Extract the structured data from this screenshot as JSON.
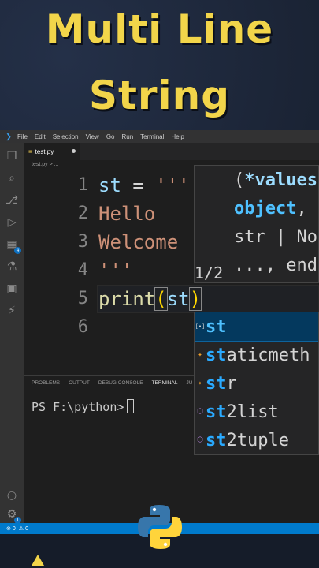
{
  "title": {
    "line1": "Multi Line",
    "line2": "String"
  },
  "menubar": {
    "items": [
      "File",
      "Edit",
      "Selection",
      "View",
      "Go",
      "Run",
      "Terminal",
      "Help"
    ]
  },
  "activitybar": {
    "badge_extensions": "4",
    "badge_settings": "1"
  },
  "tab": {
    "filename": "test.py"
  },
  "breadcrumb": {
    "text": "test.py > ..."
  },
  "editor": {
    "lines": [
      {
        "num": "1",
        "text": "st = '''"
      },
      {
        "num": "2",
        "text": "Hello"
      },
      {
        "num": "3",
        "text": "Welcome"
      },
      {
        "num": "4",
        "text": "'''"
      },
      {
        "num": "5",
        "text": "print(st)"
      },
      {
        "num": "6",
        "text": ""
      }
    ]
  },
  "param_hint": {
    "line1_paren": "(",
    "line1_param": "*values",
    "line2_type": "object",
    "line2_rest": ",",
    "line3": "str | No",
    "line4": "..., end",
    "counter": "1/2"
  },
  "suggestions": [
    {
      "match": "st",
      "rest": "",
      "kind": "keyword"
    },
    {
      "match": "st",
      "rest": "aticmeth",
      "kind": "class"
    },
    {
      "match": "st",
      "rest": "r",
      "kind": "class"
    },
    {
      "match": "st",
      "rest": "2list",
      "kind": "function"
    },
    {
      "match": "st",
      "rest": "2tuple",
      "kind": "function"
    }
  ],
  "panel": {
    "tabs": [
      "PROBLEMS",
      "OUTPUT",
      "DEBUG CONSOLE",
      "TERMINAL",
      "JU"
    ],
    "active_tab": "TERMINAL",
    "prompt": "PS F:\\python>"
  },
  "statusbar": {
    "errors": "0",
    "warnings": "0"
  }
}
